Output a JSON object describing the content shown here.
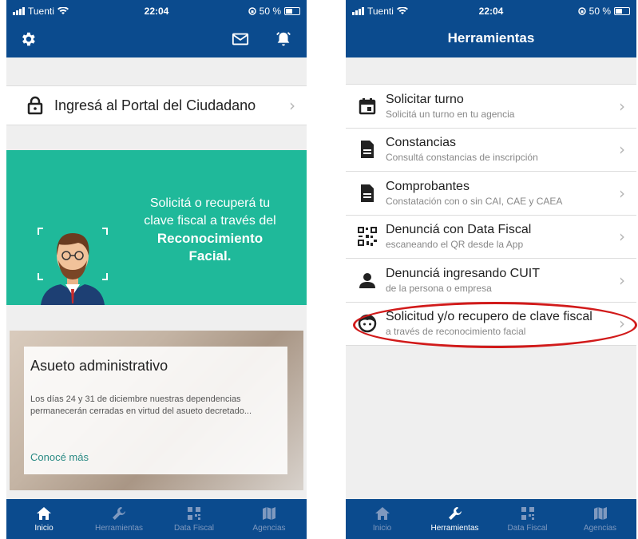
{
  "status": {
    "carrier": "Tuenti",
    "time": "22:04",
    "battery": "50 %"
  },
  "left": {
    "portal_label": "Ingresá al Portal del Ciudadano",
    "banner": {
      "line1": "Solicitá o recuperá tu",
      "line2": "clave fiscal a través del",
      "line3": "Reconocimiento",
      "line4": "Facial."
    },
    "news": {
      "title": "Asueto administrativo",
      "body": "Los días 24 y 31 de diciembre nuestras dependencias permanecerán cerradas en virtud del asueto decretado...",
      "link": "Conocé más"
    }
  },
  "right": {
    "header_title": "Herramientas",
    "items": [
      {
        "title": "Solicitar turno",
        "subtitle": "Solicitá un turno en tu agencia",
        "icon": "calendar-icon"
      },
      {
        "title": "Constancias",
        "subtitle": "Consultá constancias de inscripción",
        "icon": "document-icon"
      },
      {
        "title": "Comprobantes",
        "subtitle": "Constatación con o sin CAI, CAE y CAEA",
        "icon": "document-icon"
      },
      {
        "title": "Denunciá con Data Fiscal",
        "subtitle": "escaneando el QR desde la App",
        "icon": "qr-code-icon"
      },
      {
        "title": "Denunciá ingresando CUIT",
        "subtitle": "de la persona o empresa",
        "icon": "person-icon"
      },
      {
        "title": "Solicitud y/o recupero de clave fiscal",
        "subtitle": "a través de reconocimiento facial",
        "icon": "face-icon"
      }
    ]
  },
  "tabs": [
    {
      "label": "Inicio",
      "icon": "home-icon"
    },
    {
      "label": "Herramientas",
      "icon": "wrench-icon"
    },
    {
      "label": "Data Fiscal",
      "icon": "qr-code-icon"
    },
    {
      "label": "Agencias",
      "icon": "map-icon"
    }
  ],
  "colors": {
    "brand_blue": "#0b4b8e",
    "banner_green": "#1fb99a",
    "highlight_red": "#d11a1a",
    "link_teal": "#2a8a84"
  }
}
